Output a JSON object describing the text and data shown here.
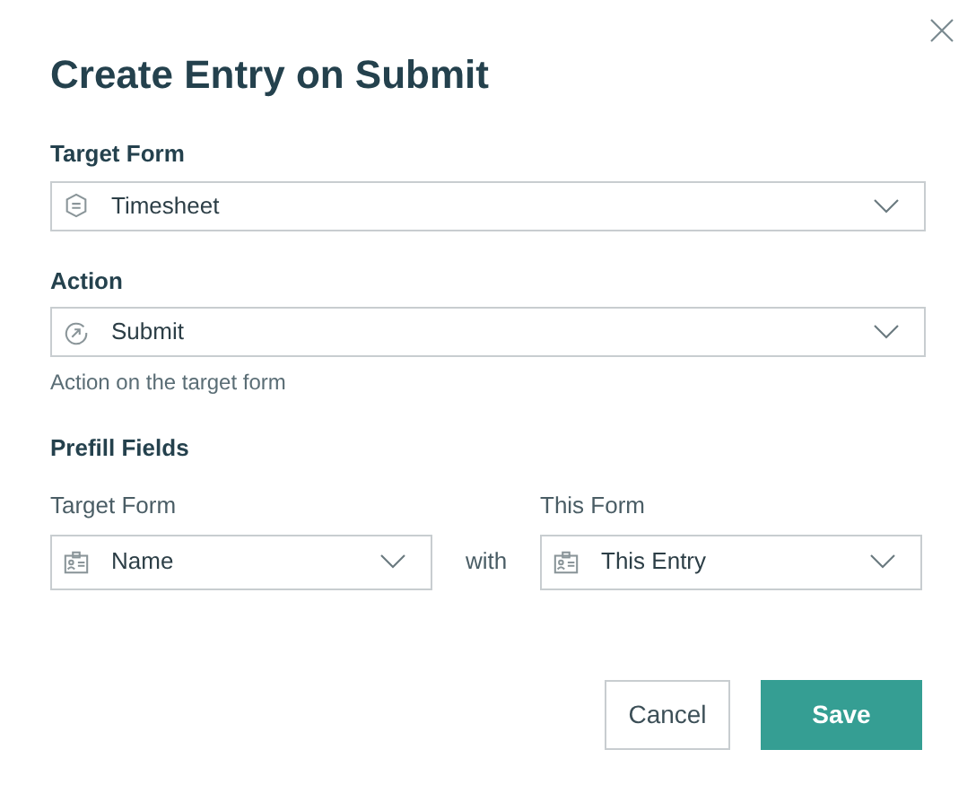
{
  "dialog": {
    "title": "Create Entry on Submit"
  },
  "fields": [
    {
      "label": "Target Form",
      "value": "Timesheet"
    },
    {
      "label": "Action",
      "value": "Submit",
      "help": "Action on the target form"
    }
  ],
  "prefill": {
    "title": "Prefill Fields",
    "left_label": "Target Form",
    "right_label": "This Form",
    "joiner": "with",
    "left": {
      "value": "Name"
    },
    "right": {
      "value": "This Entry"
    }
  },
  "buttons": [
    {
      "label": "Cancel",
      "kind": "secondary"
    },
    {
      "label": "Save",
      "kind": "primary"
    }
  ]
}
